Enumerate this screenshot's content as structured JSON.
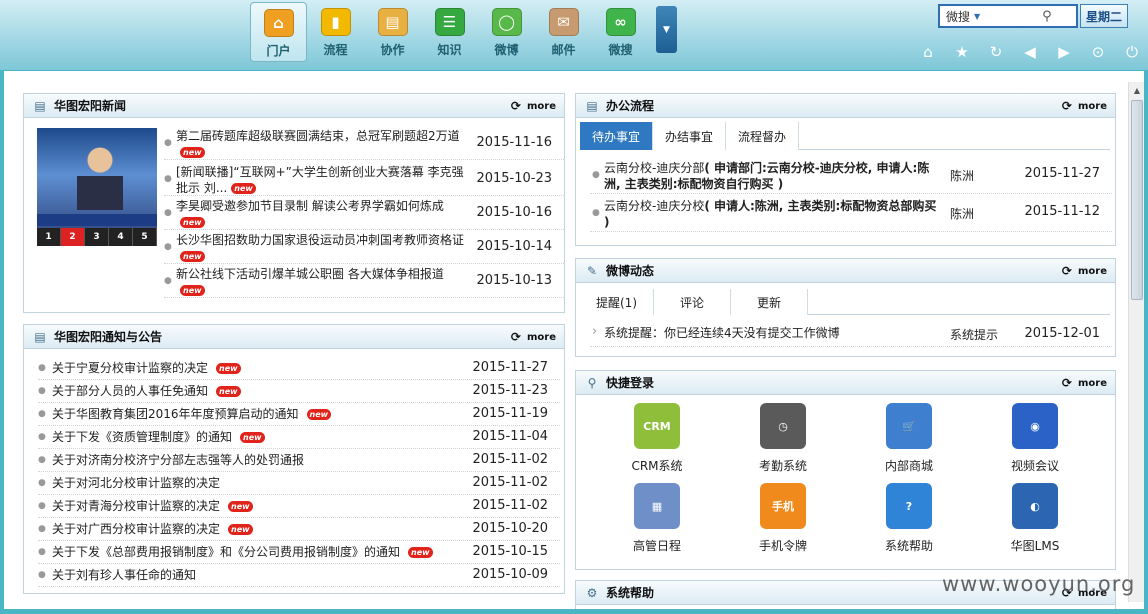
{
  "nav": {
    "items": [
      {
        "label": "门户",
        "icon": "home-icon",
        "color": "#f0a020",
        "glyph": "⌂"
      },
      {
        "label": "流程",
        "icon": "bar-chart-icon",
        "color": "#f3b800",
        "glyph": "▮"
      },
      {
        "label": "协作",
        "icon": "document-icon",
        "color": "#e8b040",
        "glyph": "▤"
      },
      {
        "label": "知识",
        "icon": "server-icon",
        "color": "#36a840",
        "glyph": "☰"
      },
      {
        "label": "微博",
        "icon": "speech-bubble-icon",
        "color": "#58b84a",
        "glyph": "◯"
      },
      {
        "label": "邮件",
        "icon": "mail-icon",
        "color": "#c89a70",
        "glyph": "✉"
      },
      {
        "label": "微搜",
        "icon": "infinity-icon",
        "color": "#3fb44a",
        "glyph": "∞"
      }
    ]
  },
  "search": {
    "selected": "微搜",
    "value": ""
  },
  "weekday": "星期二",
  "toolbar": [
    "home-icon",
    "star-icon",
    "refresh-icon",
    "back-icon",
    "forward-icon",
    "dropdown-icon",
    "power-icon"
  ],
  "news": {
    "title": "华图宏阳新闻",
    "more": "more",
    "thumb_numbers": [
      "1",
      "2",
      "3",
      "4",
      "5"
    ],
    "new_badge": "new",
    "items": [
      {
        "title": "第二届砖题库超级联赛圆满结束，总冠军刷题超2万道",
        "date": "2015-11-16"
      },
      {
        "title": "[新闻联播]“互联网+”大学生创新创业大赛落幕 李克强批示 刘...",
        "date": "2015-10-23"
      },
      {
        "title": "李昊卿受邀参加节目录制 解读公考界学霸如何炼成",
        "date": "2015-10-16"
      },
      {
        "title": "长沙华图招数助力国家退役运动员冲刺国考教师资格证",
        "date": "2015-10-14"
      },
      {
        "title": "新公社线下活动引爆羊城公职圈 各大媒体争相报道",
        "date": "2015-10-13"
      }
    ]
  },
  "notices": {
    "title": "华图宏阳通知与公告",
    "more": "more",
    "items": [
      {
        "title": "关于宁夏分校审计监察的决定",
        "date": "2015-11-27",
        "new": true
      },
      {
        "title": "关于部分人员的人事任免通知",
        "date": "2015-11-23",
        "new": true
      },
      {
        "title": "关于华图教育集团2016年年度预算启动的通知",
        "date": "2015-11-19",
        "new": true
      },
      {
        "title": "关于下发《资质管理制度》的通知",
        "date": "2015-11-04",
        "new": true
      },
      {
        "title": "关于对济南分校济宁分部左志强等人的处罚通报",
        "date": "2015-11-02",
        "new": false
      },
      {
        "title": "关于对河北分校审计监察的决定",
        "date": "2015-11-02",
        "new": false
      },
      {
        "title": "关于对青海分校审计监察的决定",
        "date": "2015-11-02",
        "new": true
      },
      {
        "title": "关于对广西分校审计监察的决定",
        "date": "2015-10-20",
        "new": true
      },
      {
        "title": "关于下发《总部费用报销制度》和《分公司费用报销制度》的通知",
        "date": "2015-10-15",
        "new": true
      },
      {
        "title": "关于刘有珍人事任命的通知",
        "date": "2015-10-09",
        "new": false
      }
    ]
  },
  "workflow": {
    "title": "办公流程",
    "more": "more",
    "tabs": [
      "待办事宜",
      "办结事宜",
      "流程督办"
    ],
    "items": [
      {
        "prefix": "云南分校-迪庆分部",
        "detail": "( 申请部门:云南分校-迪庆分校, 申请人:陈洲, 主表类别:标配物资自行购买 )",
        "person": "陈洲",
        "date": "2015-11-27"
      },
      {
        "prefix": "云南分校-迪庆分校",
        "detail": "( 申请人:陈洲, 主表类别:标配物资总部购买 )",
        "person": "陈洲",
        "date": "2015-11-12"
      }
    ]
  },
  "weibo": {
    "title": "微博动态",
    "more": "more",
    "tabs": [
      "提醒(1)",
      "评论",
      "更新"
    ],
    "items": [
      {
        "title": "系统提醒：你已经连续4天没有提交工作微博",
        "source": "系统提示",
        "date": "2015-12-01"
      }
    ]
  },
  "quick": {
    "title": "快捷登录",
    "more": "more",
    "apps": [
      {
        "label": "CRM系统",
        "name": "crm-icon",
        "glyph": "CRM",
        "color": "#8fbf3a"
      },
      {
        "label": "考勤系统",
        "name": "clock-icon",
        "glyph": "◷",
        "color": "#5a5a5a"
      },
      {
        "label": "内部商城",
        "name": "cart-icon",
        "glyph": "🛒",
        "color": "#3f7fd0"
      },
      {
        "label": "视频会议",
        "name": "webcam-icon",
        "glyph": "◉",
        "color": "#2a62c8"
      },
      {
        "label": "高管日程",
        "name": "calendar-icon",
        "glyph": "▦",
        "color": "#6f8fc8"
      },
      {
        "label": "手机令牌",
        "name": "mobile-token-icon",
        "glyph": "手机",
        "color": "#f08a1c"
      },
      {
        "label": "系统帮助",
        "name": "help-icon",
        "glyph": "?",
        "color": "#2f84d8"
      },
      {
        "label": "华图LMS",
        "name": "globe-icon",
        "glyph": "◐",
        "color": "#2c66b3"
      }
    ]
  },
  "help": {
    "title": "系统帮助",
    "more": "more"
  },
  "watermark": "www.wooyun.org"
}
